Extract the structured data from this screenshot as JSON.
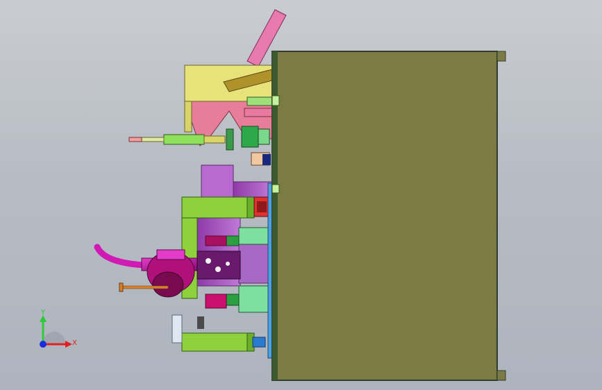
{
  "scene": {
    "view": "cad-model-top-view",
    "background_color": "#bfc3c9",
    "colors": {
      "base_plate": "#7c7a45",
      "base_plate_edge": "#2f3d2a",
      "green_frame": "#8fd13c",
      "magenta_motor": "#cc10b0",
      "purple_body": "#b36ad1",
      "pink_chute": "#e97ab0",
      "yellow_block": "#e8e27a",
      "blue_rail": "#4aa0e0",
      "orange_rod": "#d6802c"
    }
  },
  "triad": {
    "y_label": "Y",
    "x_label": "X",
    "y_color": "#2ec93a",
    "x_color": "#e02020",
    "z_color": "#1a2ee0"
  }
}
